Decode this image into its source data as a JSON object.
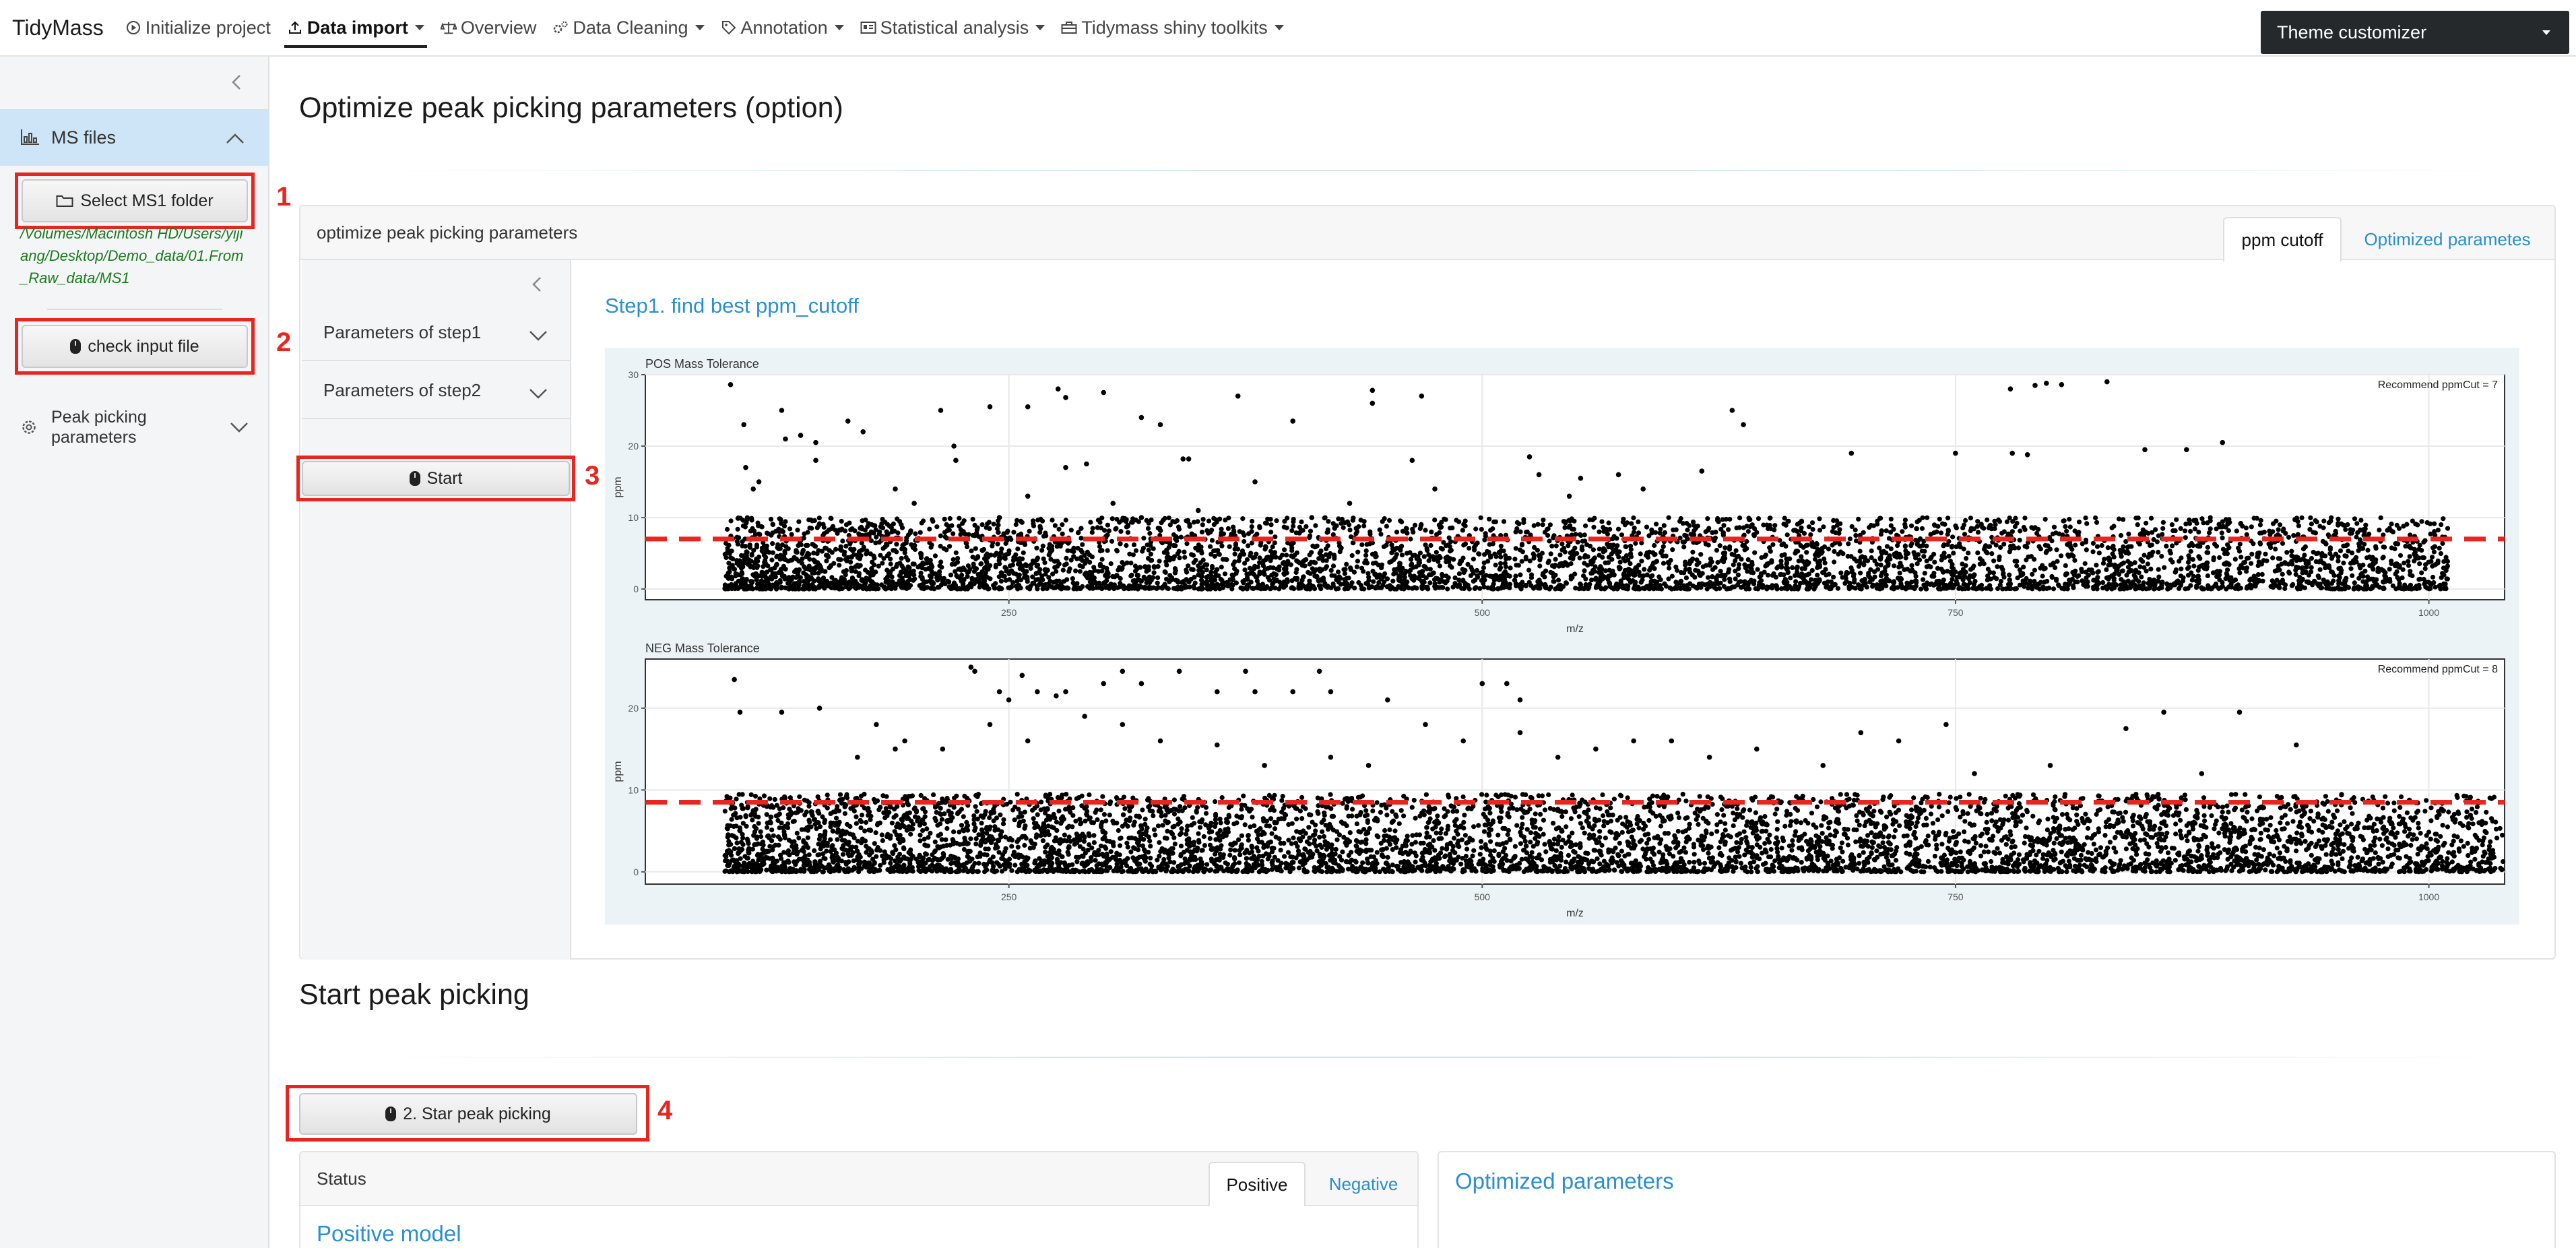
{
  "app": {
    "brand": "TidyMass"
  },
  "navbar": {
    "items": [
      {
        "label": "Initialize project",
        "icon": "play-circle-icon",
        "active": false,
        "dropdown": false
      },
      {
        "label": "Data import",
        "icon": "upload-icon",
        "active": true,
        "dropdown": true
      },
      {
        "label": "Overview",
        "icon": "balance-scale-icon",
        "active": false,
        "dropdown": false
      },
      {
        "label": "Data Cleaning",
        "icon": "cogs-icon",
        "active": false,
        "dropdown": true
      },
      {
        "label": "Annotation",
        "icon": "tags-icon",
        "active": false,
        "dropdown": true
      },
      {
        "label": "Statistical analysis",
        "icon": "id-card-icon",
        "active": false,
        "dropdown": true
      },
      {
        "label": "Tidymass shiny toolkits",
        "icon": "toolbox-icon",
        "active": false,
        "dropdown": true
      }
    ],
    "theme_label": "Theme customizer"
  },
  "sidebar": {
    "ms_files_label": "MS files",
    "select_folder_label": "Select MS1 folder",
    "folder_path": "/Volumes/Macintosh HD/Users/yijiang/Desktop/Demo_data/01.From_Raw_data/MS1",
    "check_input_label": "check input file",
    "peak_picking_label": "Peak picking parameters"
  },
  "annotations": {
    "n1": "1",
    "n2": "2",
    "n3": "3",
    "n4": "4"
  },
  "main": {
    "section_title": "Optimize peak picking parameters (option)",
    "card_title": "optimize peak picking parameters",
    "tabs": [
      {
        "label": "ppm cutoff",
        "active": true
      },
      {
        "label": "Optimized parametes",
        "active": false
      }
    ],
    "param_step1": "Parameters of step1",
    "param_step2": "Parameters of step2",
    "start_label": "Start",
    "step_title": "Step1. find best ppm_cutoff",
    "section2_title": "Start peak picking",
    "star_button_label": "2. Star peak picking",
    "status_title": "Status",
    "status_tabs": [
      {
        "label": "Positive",
        "active": true
      },
      {
        "label": "Negative",
        "active": false
      }
    ],
    "positive_model_title": "Positive model",
    "optimized_params_title": "Optimized parameters"
  },
  "colors": {
    "accent": "#2a8fd0",
    "annotation_red": "#e8261f",
    "threshold_line": "#e8261f",
    "sidebar_active": "#cde5f7"
  },
  "chart_data": [
    {
      "type": "scatter",
      "title": "POS Mass Tolerance",
      "annotation": "Recommend ppmCut = 7",
      "xlabel": "m/z",
      "ylabel": "ppm",
      "xlim": [
        58,
        1040
      ],
      "ylim": [
        -1.5,
        30
      ],
      "xticks": [
        250,
        500,
        750,
        1000
      ],
      "yticks": [
        0,
        10,
        20,
        30
      ],
      "threshold": 7,
      "grid": true,
      "seed": 11,
      "n_dense": 5200,
      "dense_xrange": [
        100,
        1010
      ],
      "dense_ymax": 10,
      "outliers": [
        [
          103,
          28.6
        ],
        [
          110,
          23
        ],
        [
          130,
          25
        ],
        [
          132,
          21
        ],
        [
          140,
          21.5
        ],
        [
          148,
          20.5
        ],
        [
          165,
          23.5
        ],
        [
          173,
          22
        ],
        [
          214,
          25
        ],
        [
          221,
          20
        ],
        [
          240,
          25.5
        ],
        [
          260,
          25.5
        ],
        [
          276,
          28
        ],
        [
          280,
          26.8
        ],
        [
          300,
          27.5
        ],
        [
          320,
          24
        ],
        [
          330,
          23
        ],
        [
          371,
          27
        ],
        [
          400,
          23.5
        ],
        [
          442,
          27.8
        ],
        [
          442,
          26
        ],
        [
          468,
          27
        ],
        [
          148,
          18
        ],
        [
          222,
          18
        ],
        [
          342,
          18.2
        ],
        [
          345,
          18.2
        ],
        [
          463,
          18
        ],
        [
          475,
          14
        ],
        [
          525,
          18.5
        ],
        [
          530,
          16
        ],
        [
          546,
          13
        ],
        [
          552,
          15.5
        ],
        [
          572,
          16
        ],
        [
          585,
          14
        ],
        [
          616,
          16.5
        ],
        [
          632,
          25
        ],
        [
          638,
          23
        ],
        [
          695,
          19
        ],
        [
          750,
          19
        ],
        [
          779,
          28
        ],
        [
          792,
          28.5
        ],
        [
          798,
          28.8
        ],
        [
          806,
          28.6
        ],
        [
          830,
          29
        ],
        [
          850,
          19.5
        ],
        [
          872,
          19.5
        ],
        [
          891,
          20.5
        ],
        [
          780,
          19
        ],
        [
          788,
          18.8
        ],
        [
          111,
          17
        ],
        [
          115,
          14
        ],
        [
          118,
          15
        ],
        [
          190,
          14
        ],
        [
          200,
          12
        ],
        [
          245,
          10
        ],
        [
          260,
          13
        ],
        [
          280,
          17
        ],
        [
          291,
          17.5
        ],
        [
          305,
          12
        ],
        [
          320,
          10
        ],
        [
          350,
          11
        ],
        [
          380,
          15
        ],
        [
          410,
          10
        ],
        [
          430,
          12
        ]
      ]
    },
    {
      "type": "scatter",
      "title": "NEG Mass Tolerance",
      "annotation": "Recommend ppmCut = 8",
      "xlabel": "m/z",
      "ylabel": "ppm",
      "xlim": [
        58,
        1040
      ],
      "ylim": [
        -1.5,
        26
      ],
      "xticks": [
        250,
        500,
        750,
        1000
      ],
      "yticks": [
        0,
        10,
        20
      ],
      "threshold": 8.5,
      "grid": true,
      "seed": 29,
      "n_dense": 5800,
      "dense_xrange": [
        100,
        1040
      ],
      "dense_ymax": 9.5,
      "outliers": [
        [
          105,
          23.5
        ],
        [
          108,
          19.5
        ],
        [
          130,
          19.5
        ],
        [
          150,
          20
        ],
        [
          180,
          18
        ],
        [
          195,
          16
        ],
        [
          230,
          25
        ],
        [
          232,
          24.5
        ],
        [
          245,
          22
        ],
        [
          250,
          21
        ],
        [
          257,
          24
        ],
        [
          265,
          22
        ],
        [
          275,
          21.5
        ],
        [
          280,
          22
        ],
        [
          300,
          23
        ],
        [
          310,
          24.5
        ],
        [
          320,
          23
        ],
        [
          340,
          24.5
        ],
        [
          360,
          22
        ],
        [
          375,
          24.5
        ],
        [
          380,
          22
        ],
        [
          400,
          22
        ],
        [
          414,
          24.5
        ],
        [
          420,
          22
        ],
        [
          450,
          21
        ],
        [
          500,
          23
        ],
        [
          513,
          23
        ],
        [
          520,
          21
        ],
        [
          600,
          16
        ],
        [
          645,
          15
        ],
        [
          700,
          17
        ],
        [
          745,
          18
        ],
        [
          840,
          17.5
        ],
        [
          860,
          19.5
        ],
        [
          900,
          19.5
        ],
        [
          930,
          15.5
        ],
        [
          170,
          14
        ],
        [
          190,
          15
        ],
        [
          215,
          15
        ],
        [
          240,
          18
        ],
        [
          260,
          16
        ],
        [
          290,
          19
        ],
        [
          310,
          18
        ],
        [
          330,
          16
        ],
        [
          360,
          15.5
        ],
        [
          385,
          13
        ],
        [
          420,
          14
        ],
        [
          440,
          13
        ],
        [
          470,
          18
        ],
        [
          490,
          16
        ],
        [
          520,
          17
        ],
        [
          540,
          14
        ],
        [
          560,
          15
        ],
        [
          580,
          16
        ],
        [
          620,
          14
        ],
        [
          680,
          13
        ],
        [
          720,
          16
        ],
        [
          760,
          12
        ],
        [
          800,
          13
        ],
        [
          880,
          12
        ]
      ]
    }
  ]
}
